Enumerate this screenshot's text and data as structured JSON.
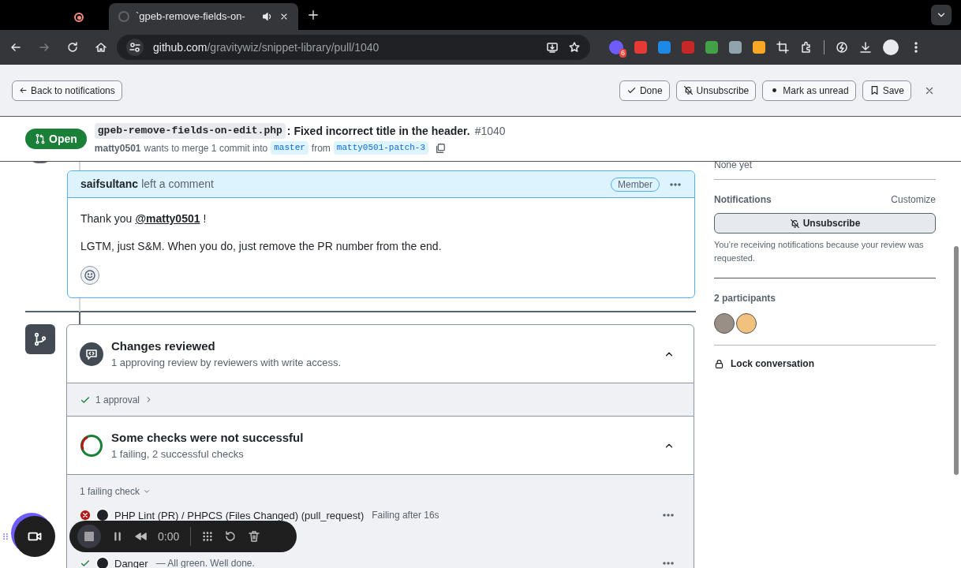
{
  "browser": {
    "tabs": [
      {
        "kind": "recording",
        "selected": false
      },
      {
        "kind": "page",
        "title": "`gpeb-remove-fields-on-",
        "selected": true
      }
    ],
    "url_host": "github.com",
    "url_path": "/gravitywiz/snippet-library/pull/1040",
    "extension_badge": "6"
  },
  "notification_bar": {
    "back": "Back to notifications",
    "buttons": [
      {
        "kind": "check",
        "label": "Done"
      },
      {
        "kind": "bell-off",
        "label": "Unsubscribe"
      },
      {
        "kind": "dot",
        "label": "Mark as unread"
      },
      {
        "kind": "bookmark",
        "label": "Save"
      }
    ]
  },
  "header": {
    "state": "Open",
    "title_code": "gpeb-remove-fields-on-edit.php",
    "title_text": ": Fixed incorrect title in the header.",
    "number": "#1040",
    "author": "matty0501",
    "merge_text": "wants to merge 1 commit into",
    "base": "master",
    "from": "from",
    "head": "matty0501-patch-3"
  },
  "comment": {
    "author": "saifsultanc",
    "action": "left a comment",
    "badge": "Member",
    "greeting": "Thank you",
    "mention": "@matty0501",
    "greeting_end": "!",
    "body": "LGTM, just S&M. When you do, just remove the PR number from the end."
  },
  "merge_box": {
    "review": {
      "title": "Changes reviewed",
      "subtitle": "1 approving review by reviewers with write access.",
      "approvals": "1 approval"
    },
    "checks": {
      "title": "Some checks were not successful",
      "subtitle": "1 failing, 2 successful checks",
      "group": "1 failing check",
      "rows": [
        {
          "passed": false,
          "name": "PHP Lint (PR) / PHPCS (Files Changed) (pull_request)",
          "detail": "Failing after 16s"
        },
        {
          "passed": true,
          "name": "Danger",
          "detail": "— All green. Well done."
        }
      ]
    }
  },
  "sidebar": {
    "reviewers_value": "None yet",
    "notifications_heading": "Notifications",
    "customize": "Customize",
    "unsubscribe": "Unsubscribe",
    "reason": "You’re receiving notifications because your review was requested.",
    "participants_heading": "2 participants",
    "participants": [
      {
        "kind": "photo"
      },
      {
        "kind": "illustration"
      }
    ],
    "lock": "Lock conversation"
  },
  "recorder": {
    "time": "0:00"
  }
}
